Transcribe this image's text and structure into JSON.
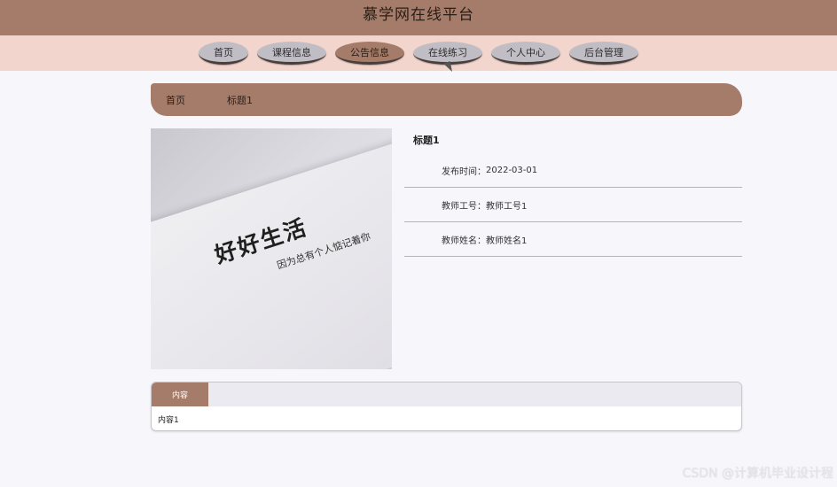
{
  "app_title": "慕学网在线平台",
  "nav": [
    {
      "label": "首页"
    },
    {
      "label": "课程信息"
    },
    {
      "label": "公告信息"
    },
    {
      "label": "在线练习"
    },
    {
      "label": "个人中心"
    },
    {
      "label": "后台管理"
    }
  ],
  "breadcrumb": {
    "home": "首页",
    "current": "标题1"
  },
  "cover": {
    "main_text": "好好生活",
    "sub_text": "因为总有个人惦记着你"
  },
  "detail": {
    "title": "标题1",
    "rows": [
      {
        "label": "发布时间：",
        "value": "2022-03-01"
      },
      {
        "label": "教师工号：",
        "value": "教师工号1"
      },
      {
        "label": "教师姓名：",
        "value": "教师姓名1"
      }
    ]
  },
  "content": {
    "tab_label": "内容",
    "body": "内容1"
  },
  "watermark": "CSDN @计算机毕业设计程"
}
